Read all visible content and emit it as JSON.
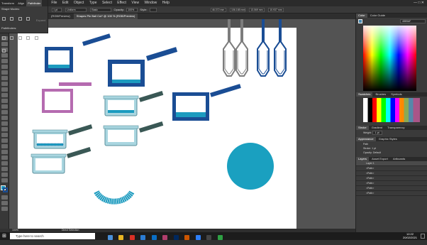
{
  "menu": {
    "items": [
      "File",
      "Edit",
      "Object",
      "Type",
      "Select",
      "Effect",
      "View",
      "Window",
      "Help"
    ]
  },
  "options": {
    "stroke_value": "1 pt",
    "stroke_profile": "Uniform",
    "brush": "Basic",
    "opacity_label": "Opacity:",
    "opacity_value": "100%",
    "style_label": "Style:",
    "x_value": "46.372 mm",
    "y_value": "106.165 mm",
    "w_value": "13.069 mm",
    "h_value": "10.937 mm"
  },
  "left_panel": {
    "tabs": [
      "Transform",
      "Align",
      "Pathfinder"
    ],
    "active_tab": "Pathfinder",
    "shape_modes_label": "Shape Modes:",
    "pathfinders_label": "Pathfinders:",
    "expand_label": "Expand"
  },
  "document": {
    "tab_title": "Shapes Pin Ball Cut* @ 100 % (RGB/Preview)",
    "second_tab": "(RGB/Preview)",
    "zoom": "100%",
    "status_tool": "Direct Selection"
  },
  "right_panel": {
    "color_tabs": [
      "Color",
      "Color Guide"
    ],
    "hex_value": "4889AF",
    "swatch_tabs": [
      "Swatches",
      "Brushes",
      "Symbols"
    ],
    "stroke_tabs": [
      "Stroke",
      "Gradient",
      "Transparency"
    ],
    "weight_label": "Weight:",
    "weight_value": "1 pt",
    "appearance_tabs": [
      "Appearance",
      "Graphic Styles"
    ],
    "appearance_item": "Path",
    "stroke_label": "Stroke:",
    "stroke_value": "1 pt",
    "opacity_label": "Opacity:",
    "opacity_value": "Default",
    "layers_tabs": [
      "Layers",
      "Asset Export",
      "Artboards"
    ],
    "layer_name": "Layer 1",
    "layer_rows": [
      "<Path>",
      "<Path>",
      "<Path>",
      "<Path>",
      "<Path>",
      "<Path>"
    ]
  },
  "taskbar": {
    "search_placeholder": "Type here to search",
    "time": "12:22",
    "date": "20/02/2021"
  },
  "colors": {
    "dark_blue": "#1a4d94",
    "teal": "#1c9bbf",
    "light_blue": "#a9d6e0",
    "slate": "#3a5855",
    "magenta": "#b56bb0",
    "gray": "#7d7d7d",
    "circle": "#1aa0c0"
  }
}
